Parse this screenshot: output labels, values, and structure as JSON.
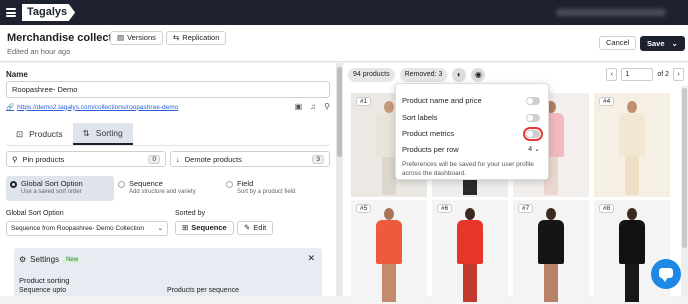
{
  "topbar": {
    "brand": "Tagalys"
  },
  "header": {
    "title": "Merchandise collection",
    "subtitle": "Edited an hour ago",
    "versions_label": "Versions",
    "replication_label": "Replication",
    "cancel_label": "Cancel",
    "save_label": "Save"
  },
  "form": {
    "name_label": "Name",
    "name_value": "Roopashree- Demo",
    "url": "https://demo2.tagalys.com/collections/roopashree-demo",
    "tabs": [
      {
        "label": "Products",
        "active": false
      },
      {
        "label": "Sorting",
        "active": true
      }
    ],
    "pin_label": "Pin products",
    "pin_count": "0",
    "demote_label": "Demote products",
    "demote_count": "3",
    "sort_options": [
      {
        "title": "Global Sort Option",
        "desc": "Use a saved sort order",
        "selected": true
      },
      {
        "title": "Sequence",
        "desc": "Add structure and variety",
        "selected": false
      },
      {
        "title": "Field",
        "desc": "Sort by a product field",
        "selected": false
      }
    ],
    "gso_label": "Global Sort Option",
    "gso_value": "Sequence from Roopashree- Demo Collection",
    "sorted_by_label": "Sorted by",
    "sorted_by_value": "Sequence",
    "edit_label": "Edit",
    "settings_title": "Settings",
    "settings_badge": "New",
    "product_sorting": "Product sorting",
    "sequence_upto": "Sequence upto",
    "products_per_sequence": "Products per sequence"
  },
  "preview": {
    "product_count": "94 products",
    "removed": "Removed: 3",
    "page_value": "1",
    "page_of": "of 2",
    "cards": [
      "#1",
      "#2",
      "#3",
      "#4",
      "#5",
      "#6",
      "#7",
      "#8"
    ]
  },
  "popover": {
    "name_price": "Product name and price",
    "sort_labels": "Sort labels",
    "metrics": "Product metrics",
    "per_row_label": "Products per row",
    "per_row_value": "4",
    "note": "Preferences will be saved for your user profile across the dashboard."
  },
  "colors": {
    "dark": "#1e2230",
    "highlight": "#e53935",
    "chat": "#1e88e5"
  }
}
